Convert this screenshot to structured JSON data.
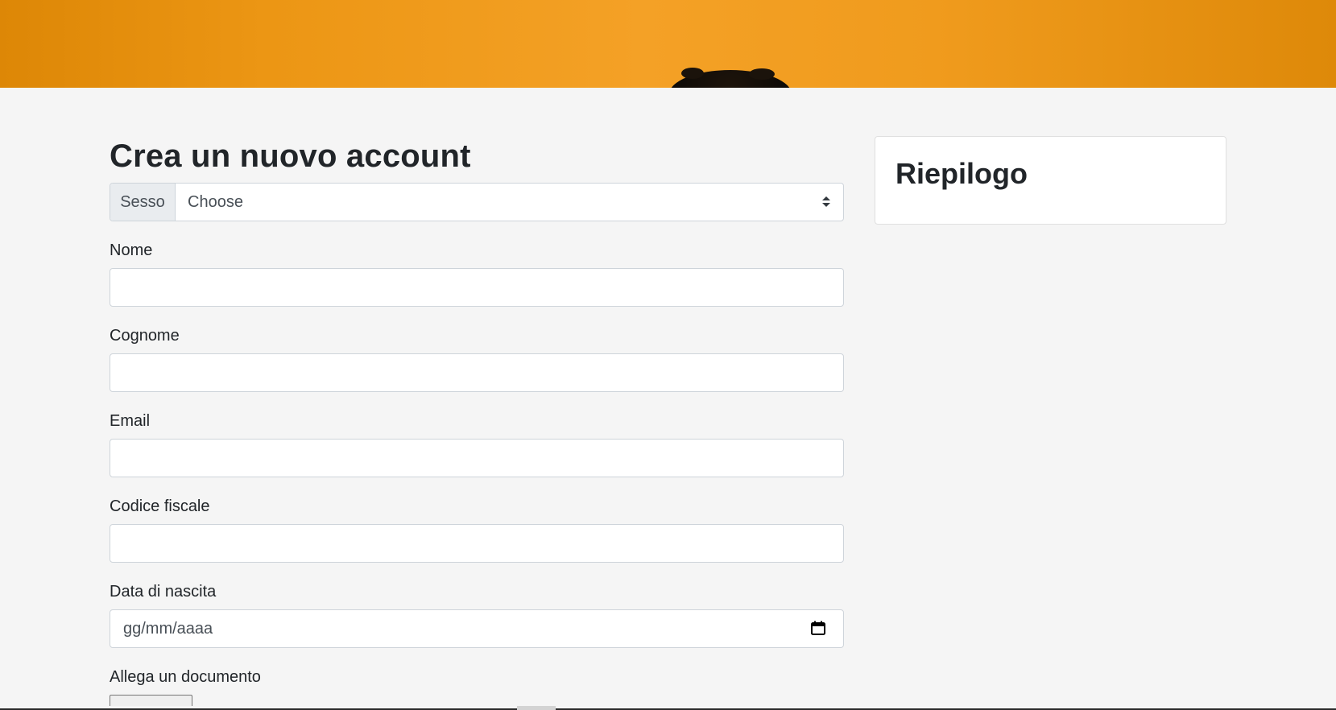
{
  "hero": {
    "colors": {
      "primary": "#f4a126",
      "edge": "#dd8706"
    }
  },
  "form": {
    "title": "Crea un nuovo account",
    "gender": {
      "label": "Sesso",
      "selected": "Choose"
    },
    "fields": {
      "first_name": {
        "label": "Nome",
        "value": ""
      },
      "last_name": {
        "label": "Cognome",
        "value": ""
      },
      "email": {
        "label": "Email",
        "value": ""
      },
      "tax_code": {
        "label": "Codice fiscale",
        "value": ""
      },
      "birth_date": {
        "label": "Data di nascita",
        "placeholder": "gg/mm/aaaa",
        "icon": "calendar-icon"
      },
      "document": {
        "label": "Allega un documento"
      }
    }
  },
  "summary": {
    "title": "Riepilogo"
  },
  "colors": {
    "page_background": "#f5f5f5",
    "input_border": "#ced4da",
    "text": "#212529",
    "muted_text": "#495057"
  }
}
